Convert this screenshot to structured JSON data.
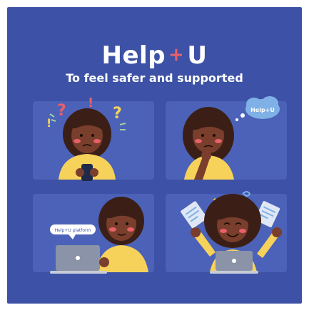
{
  "header": {
    "brand_left": "Help",
    "brand_plus": "+",
    "brand_right": "U",
    "tagline": "To feel safer and supported"
  },
  "scenes": {
    "bubble_label": "Help+U",
    "speech_label": "Help+U platform"
  },
  "colors": {
    "background": "#3d52a6",
    "panel": "#4b62b8",
    "accent": "#e8606a",
    "skin": "#7a3e2c",
    "shirt": "#f6d25a",
    "hair": "#3b1f16"
  }
}
